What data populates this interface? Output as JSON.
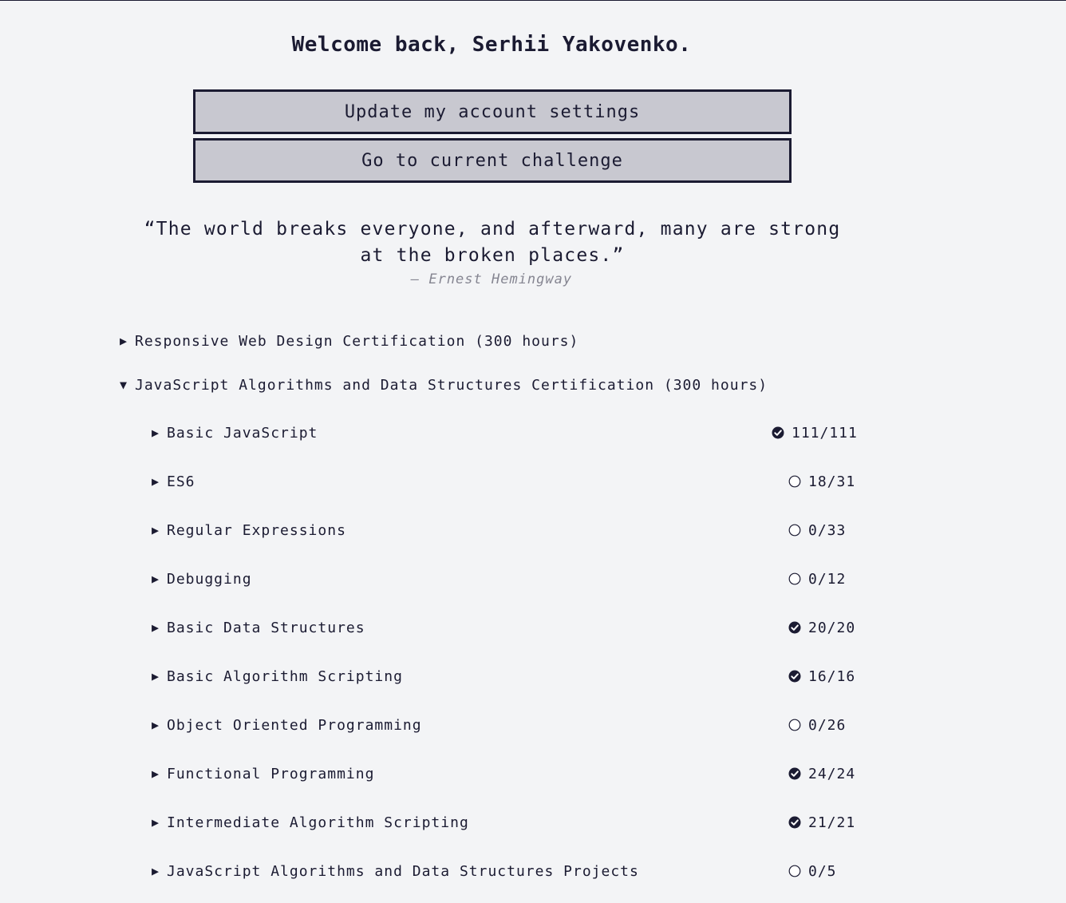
{
  "welcome": "Welcome back, Serhii Yakovenko.",
  "buttons": {
    "settings": "Update my account settings",
    "challenge": "Go to current challenge"
  },
  "quote": {
    "text": "“The world breaks everyone, and afterward, many are strong at the broken places.”",
    "author": "— Ernest Hemingway"
  },
  "certifications": [
    {
      "arrow": "▶",
      "label": "Responsive Web Design Certification (300 hours)",
      "expanded": false
    },
    {
      "arrow": "▼",
      "label": "JavaScript Algorithms and Data Structures Certification (300 hours)",
      "expanded": true
    }
  ],
  "blocks": [
    {
      "arrow": "▶",
      "name": "Basic JavaScript",
      "progress": "111/111",
      "complete": true
    },
    {
      "arrow": "▶",
      "name": "ES6",
      "progress": "18/31",
      "complete": false
    },
    {
      "arrow": "▶",
      "name": "Regular Expressions",
      "progress": "0/33",
      "complete": false
    },
    {
      "arrow": "▶",
      "name": "Debugging",
      "progress": "0/12",
      "complete": false
    },
    {
      "arrow": "▶",
      "name": "Basic Data Structures",
      "progress": "20/20",
      "complete": true
    },
    {
      "arrow": "▶",
      "name": "Basic Algorithm Scripting",
      "progress": "16/16",
      "complete": true
    },
    {
      "arrow": "▶",
      "name": "Object Oriented Programming",
      "progress": "0/26",
      "complete": false
    },
    {
      "arrow": "▶",
      "name": "Functional Programming",
      "progress": "24/24",
      "complete": true
    },
    {
      "arrow": "▶",
      "name": "Intermediate Algorithm Scripting",
      "progress": "21/21",
      "complete": true
    },
    {
      "arrow": "▶",
      "name": "JavaScript Algorithms and Data Structures Projects",
      "progress": "0/5",
      "complete": false
    }
  ],
  "icons": {
    "complete": "check-circle-icon",
    "incomplete": "empty-circle-icon"
  },
  "colors": {
    "background": "#f3f4f6",
    "text": "#1b1b32",
    "button_bg": "#c8c8d0",
    "muted": "#858591"
  }
}
